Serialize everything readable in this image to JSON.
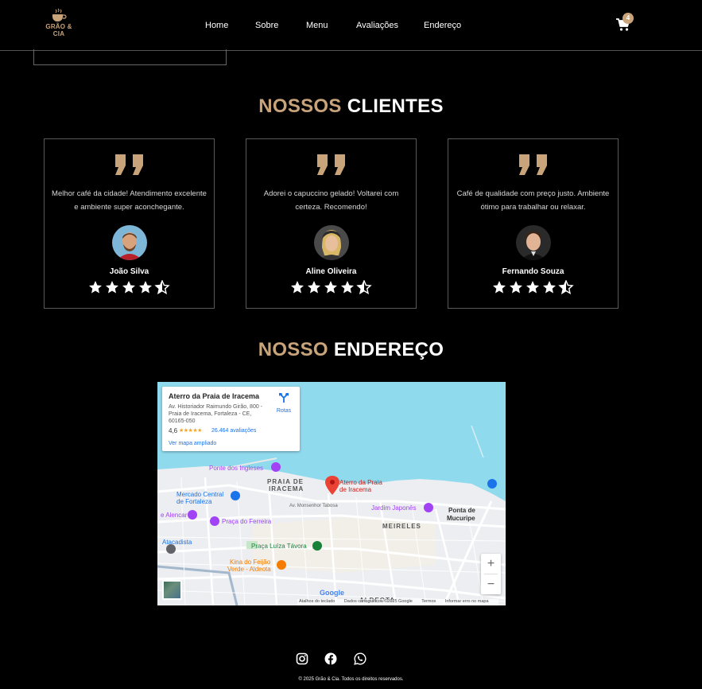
{
  "header": {
    "logo_text": "GRÃO & CIA",
    "nav": [
      "Home",
      "Sobre",
      "Menu",
      "Avaliações",
      "Endereço"
    ],
    "cart_count": "4",
    "cart_icon": "shopping-cart-icon"
  },
  "clients": {
    "title_accent": "NOSSOS",
    "title_main": "CLIENTES",
    "testimonials": [
      {
        "text": "Melhor café da cidade! Atendimento excelente e ambiente super aconchegante.",
        "name": "João Silva",
        "rating": 4.5
      },
      {
        "text": "Adorei o capuccino gelado! Voltarei com certeza. Recomendo!",
        "name": "Aline Oliveira",
        "rating": 4.5
      },
      {
        "text": "Café de qualidade com preço justo. Ambiente ótimo para trabalhar ou relaxar.",
        "name": "Fernando Souza",
        "rating": 4.5
      }
    ]
  },
  "address": {
    "title_accent": "NOSSO",
    "title_main": "ENDEREÇO",
    "map": {
      "place_name": "Aterro da Praia de Iracema",
      "place_address": "Av. Historiador Raimundo Girão, 800 - Praia de Iracema, Fortaleza - CE, 60165-050",
      "rating": "4,6",
      "stars": "★★★★★",
      "reviews": "26.464 avaliações",
      "view_larger": "Ver mapa ampliado",
      "routes": "Rotas",
      "labels": {
        "ponte_ingleses": "Ponte dos Ingleses",
        "praia_iracema_1": "PRAIA DE",
        "praia_iracema_2": "IRACEMA",
        "pin_1": "Aterro da Praia",
        "pin_2": "de Iracema",
        "mercado_1": "Mercado Central",
        "mercado_2": "de Fortaleza",
        "alencar": "e Alencar",
        "praca_ferreira": "Praça do Ferreira",
        "atacadista": "Atacadista",
        "jardim_japones": "Jardim Japonês",
        "meireles": "MEIRELES",
        "ponta_1": "Ponta de",
        "ponta_2": "Mucuripe",
        "praca_luiza": "Praça Luíza Távora",
        "kina_1": "Kina do Feijão",
        "kina_2": "Verde - Aldeota",
        "av_monsenhor": "Av. Monsenhor Tabosa",
        "aldeota": "ALDEOTA"
      },
      "google": "Google",
      "footer": [
        "Atalhos do teclado",
        "Dados cartográficos ©2025 Google",
        "Termos",
        "Informar erro no mapa"
      ],
      "zoom_in": "+",
      "zoom_out": "−"
    }
  },
  "footer": {
    "social": [
      "instagram-icon",
      "facebook-icon",
      "whatsapp-icon"
    ],
    "copyright": "© 2025 Grão & Cia. Todos os direitos reservados."
  },
  "colors": {
    "accent": "#c9a47a",
    "background": "#000000"
  }
}
